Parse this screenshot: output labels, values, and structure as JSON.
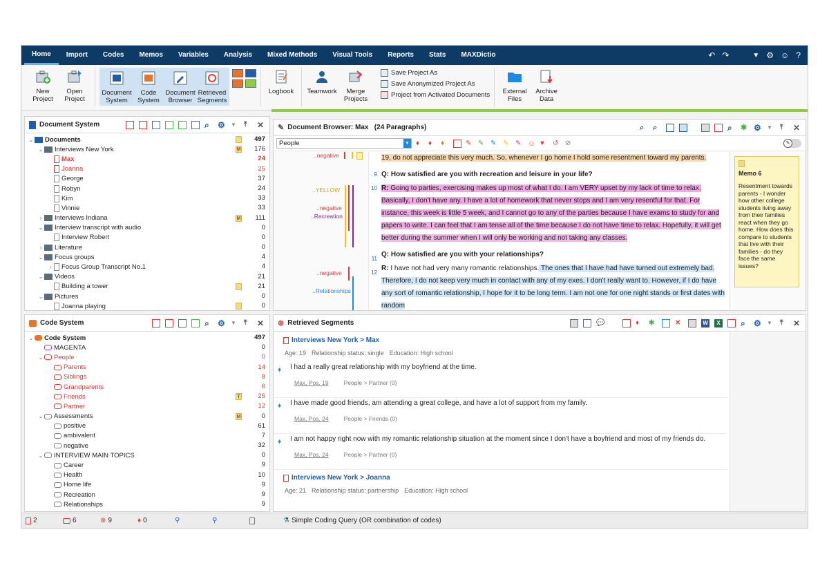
{
  "menu": {
    "items": [
      "Home",
      "Import",
      "Codes",
      "Memos",
      "Variables",
      "Analysis",
      "Mixed Methods",
      "Visual Tools",
      "Reports",
      "Stats",
      "MAXDictio"
    ],
    "active": "Home"
  },
  "ribbon": {
    "new_project": "New\nProject",
    "open_project": "Open\nProject",
    "document_system": "Document\nSystem",
    "code_system": "Code\nSystem",
    "document_browser": "Document\nBrowser",
    "retrieved_segments": "Retrieved\nSegments",
    "logbook": "Logbook",
    "teamwork": "Teamwork",
    "merge_projects": "Merge\nProjects",
    "save_project_as": "Save Project As",
    "save_anonymized": "Save Anonymized Project As",
    "project_from_activated": "Project from Activated Documents",
    "external_files": "External\nFiles",
    "archive_data": "Archive\nData"
  },
  "document_system": {
    "title": "Document System",
    "rows": [
      {
        "label": "Documents",
        "count": "497",
        "level": 0,
        "arrow": "v",
        "bold": true,
        "red": false,
        "memo": "memo"
      },
      {
        "label": "Interviews New York",
        "count": "176",
        "level": 1,
        "arrow": "v",
        "bold": false,
        "red": false,
        "memo": "m"
      },
      {
        "label": "Max",
        "count": "24",
        "level": 2,
        "arrow": "",
        "bold": true,
        "red": true,
        "memo": ""
      },
      {
        "label": "Joanna",
        "count": "25",
        "level": 2,
        "arrow": "",
        "bold": false,
        "red": true,
        "memo": ""
      },
      {
        "label": "George",
        "count": "37",
        "level": 2,
        "arrow": "",
        "bold": false,
        "red": false,
        "memo": ""
      },
      {
        "label": "Robyn",
        "count": "24",
        "level": 2,
        "arrow": "",
        "bold": false,
        "red": false,
        "memo": ""
      },
      {
        "label": "Kim",
        "count": "33",
        "level": 2,
        "arrow": "",
        "bold": false,
        "red": false,
        "memo": ""
      },
      {
        "label": "Vinnie",
        "count": "33",
        "level": 2,
        "arrow": "",
        "bold": false,
        "red": false,
        "memo": ""
      },
      {
        "label": "Interviews Indiana",
        "count": "111",
        "level": 1,
        "arrow": ">",
        "bold": false,
        "red": false,
        "memo": "m"
      },
      {
        "label": "Interview transcript with audio",
        "count": "0",
        "level": 1,
        "arrow": "v",
        "bold": false,
        "red": false,
        "memo": ""
      },
      {
        "label": "Interview Robert",
        "count": "0",
        "level": 2,
        "arrow": "",
        "bold": false,
        "red": false,
        "memo": ""
      },
      {
        "label": "Literature",
        "count": "0",
        "level": 1,
        "arrow": ">",
        "bold": false,
        "red": false,
        "memo": ""
      },
      {
        "label": "Focus groups",
        "count": "4",
        "level": 1,
        "arrow": "v",
        "bold": false,
        "red": false,
        "memo": ""
      },
      {
        "label": "Focus Group Transcript No.1",
        "count": "4",
        "level": 2,
        "arrow": ">",
        "bold": false,
        "red": false,
        "memo": ""
      },
      {
        "label": "Videos",
        "count": "21",
        "level": 1,
        "arrow": "v",
        "bold": false,
        "red": false,
        "memo": ""
      },
      {
        "label": "Building a tower",
        "count": "21",
        "level": 2,
        "arrow": "",
        "bold": false,
        "red": false,
        "memo": "memo"
      },
      {
        "label": "Pictures",
        "count": "0",
        "level": 1,
        "arrow": "v",
        "bold": false,
        "red": false,
        "memo": ""
      },
      {
        "label": "Joanna playing",
        "count": "0",
        "level": 2,
        "arrow": "",
        "bold": false,
        "red": false,
        "memo": "memo"
      }
    ]
  },
  "code_system": {
    "title": "Code System",
    "rows": [
      {
        "label": "Code System",
        "count": "497",
        "level": 0,
        "arrow": "v",
        "bold": true,
        "red": false,
        "memo": "",
        "color": "#e8742a"
      },
      {
        "label": "MAGENTA",
        "count": "0",
        "level": 1,
        "arrow": "",
        "bold": false,
        "red": false,
        "memo": "",
        "color": "#9b3fb5"
      },
      {
        "label": "People",
        "count": "0",
        "level": 1,
        "arrow": "v",
        "bold": false,
        "red": true,
        "memo": "",
        "color": "#e53935"
      },
      {
        "label": "Parents",
        "count": "14",
        "level": 2,
        "arrow": "",
        "bold": false,
        "red": true,
        "memo": "",
        "color": "#e53935"
      },
      {
        "label": "Siblings",
        "count": "8",
        "level": 2,
        "arrow": "",
        "bold": false,
        "red": true,
        "memo": "",
        "color": "#e53935"
      },
      {
        "label": "Grandparents",
        "count": "6",
        "level": 2,
        "arrow": "",
        "bold": false,
        "red": true,
        "memo": "",
        "color": "#e53935"
      },
      {
        "label": "Friends",
        "count": "25",
        "level": 2,
        "arrow": "",
        "bold": false,
        "red": true,
        "memo": "t",
        "color": "#e53935"
      },
      {
        "label": "Partner",
        "count": "12",
        "level": 2,
        "arrow": "",
        "bold": false,
        "red": true,
        "memo": "",
        "color": "#e53935"
      },
      {
        "label": "Assessments",
        "count": "0",
        "level": 1,
        "arrow": "v",
        "bold": false,
        "red": false,
        "memo": "m",
        "color": "#7b7b7b"
      },
      {
        "label": "positive",
        "count": "61",
        "level": 2,
        "arrow": "",
        "bold": false,
        "red": false,
        "memo": "",
        "color": "#7b7b7b"
      },
      {
        "label": "ambivalent",
        "count": "7",
        "level": 2,
        "arrow": "",
        "bold": false,
        "red": false,
        "memo": "",
        "color": "#7b7b7b"
      },
      {
        "label": "negative",
        "count": "32",
        "level": 2,
        "arrow": "",
        "bold": false,
        "red": false,
        "memo": "",
        "color": "#7b7b7b"
      },
      {
        "label": "INTERVIEW MAIN TOPICS",
        "count": "0",
        "level": 1,
        "arrow": "v",
        "bold": false,
        "red": false,
        "memo": "",
        "color": "#7b7b7b"
      },
      {
        "label": "Career",
        "count": "9",
        "level": 2,
        "arrow": "",
        "bold": false,
        "red": false,
        "memo": "",
        "color": "#7b7b7b"
      },
      {
        "label": "Health",
        "count": "10",
        "level": 2,
        "arrow": "",
        "bold": false,
        "red": false,
        "memo": "",
        "color": "#7b7b7b"
      },
      {
        "label": "Home life",
        "count": "9",
        "level": 2,
        "arrow": "",
        "bold": false,
        "red": false,
        "memo": "",
        "color": "#7b7b7b"
      },
      {
        "label": "Recreation",
        "count": "9",
        "level": 2,
        "arrow": "",
        "bold": false,
        "red": false,
        "memo": "",
        "color": "#7b7b7b"
      },
      {
        "label": "Relationships",
        "count": "9",
        "level": 2,
        "arrow": "",
        "bold": false,
        "red": false,
        "memo": "",
        "color": "#7b7b7b"
      }
    ]
  },
  "document_browser": {
    "title": "Document Browser: Max   (24 Paragraphs)",
    "code_dropdown": "People",
    "para1": "19, do not appreciate this very much. So, whenever I go home I hold some resentment toward my parents.",
    "q1": "Q: How satisfied are you with recreation and leisure in your life?",
    "r1_label": "R:",
    "r1": " Going to parties, exercising makes up most of what I do. I am VERY upset by my lack of time to relax. Basically, I don't have any. I have a lot of homework that never stops and I am very resentful for that. For instance, this week is little 5 week, and I cannot go to any of the parties because I have exams to study for and papers to write. I can feel that I am tense all of the time because I do not have time to relax.",
    "r1_tail": " Hopefully, it will get better during the summer when I will only be working and not taking any classes.",
    "q2": "Q: How satisfied are you with your relationships?",
    "r2_label": "R:",
    "r2_a": " I have not had very many romantic relationships.",
    "r2_b": " The ones that I have had have turned out extremely bad. Therefore, I do not keep very much in contact with any of my exes. I don't really want to. However, if I do have any sort of romantic relationship, I hope for it to be long term. I am not one for one night stands or first dates with random",
    "para_num_9": "9",
    "para_num_10": "10",
    "para_num_11": "11",
    "para_num_12": "12",
    "code_negative_1": "..negative",
    "code_yellow": "..YELLOW",
    "code_negative_2": "..negative",
    "code_recreation": "..Recreation",
    "code_negative_3": "..negative",
    "code_relationships": "..Relationships",
    "memo_title": "Memo 6",
    "memo_text": "Resentment towards parents - I wonder how other college students living away from their families react when they go home. How does this compare to students that live with their families - do they face the same issues?"
  },
  "retrieved": {
    "title": "Retrieved Segments",
    "doc1": "Interviews New York > Max",
    "doc1_meta": {
      "age": "Age: 19",
      "rel": "Relationship status: single",
      "edu": "Education: High school"
    },
    "segments": [
      {
        "text": "I had a really great relationship with my boyfriend at the time.",
        "src": "Max, Pos. 19",
        "code": "People > Partner (0)"
      },
      {
        "text": "I have made good friends, am attending a great college, and have a lot of support from my family.",
        "src": "Max, Pos. 24",
        "code": "People > Friends (0)"
      },
      {
        "text": "I am not happy right now with my romantic relationship situation at the moment since I don't have a boyfriend and most of my friends do.",
        "src": "Max, Pos. 24",
        "code": "People > Partner (0)"
      }
    ],
    "doc2": "Interviews New York > Joanna",
    "doc2_meta": {
      "age": "Age: 21",
      "rel": "Relationship status: partnership",
      "edu": "Education: High school"
    }
  },
  "status": {
    "docs": "2",
    "codes": "6",
    "segs": "9",
    "memos": "0",
    "query": "Simple Coding Query (OR combination of codes)"
  },
  "colors": {
    "menubar": "#0e3a66",
    "accent_green": "#8ccf3a",
    "highlight_orange": "#fcd9a8",
    "highlight_pink": "#f3a8e6",
    "highlight_blue": "#cfe7fa",
    "memo_yellow": "#fdf6c3"
  }
}
